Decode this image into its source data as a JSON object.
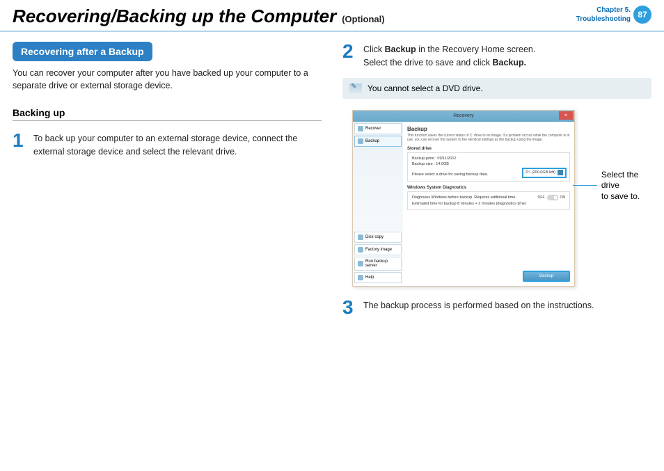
{
  "header": {
    "title": "Recovering/Backing up the Computer",
    "subtitle": "(Optional)",
    "chapter_line1": "Chapter 5.",
    "chapter_line2": "Troubleshooting",
    "page_number": "87"
  },
  "left": {
    "section_heading": "Recovering after a Backup",
    "intro": "You can recover your computer after you have backed up your computer to a separate drive or external storage device.",
    "sub_heading": "Backing up",
    "step1_num": "1",
    "step1_text": "To back up your computer to an external storage device, connect the external storage device and select the relevant drive."
  },
  "right": {
    "step2_num": "2",
    "step2_text_a": "Click ",
    "step2_bold_a": "Backup",
    "step2_text_b": " in the Recovery Home screen.",
    "step2_text_c": "Select the drive to save and click ",
    "step2_bold_b": "Backup.",
    "note": "You cannot select a DVD drive.",
    "step3_num": "3",
    "step3_text": "The backup process is performed based on the instructions."
  },
  "screenshot": {
    "title": "Recovery",
    "sidebar_recover": "Recover",
    "sidebar_backup": "Backup",
    "sidebar_diskcopy": "Disk copy",
    "sidebar_factory": "Factory image",
    "sidebar_run": "Run backup server",
    "sidebar_help": "Help",
    "panel_title": "Backup",
    "panel_desc": "This function saves the current status of C: drive to an image.\nIf a problem occurs while the computer is in use, you can recover the system to the identical settings as the backup using the image.",
    "section_stored": "Stored drive",
    "backup_point": "Backup point : 09/11/2012",
    "backup_size": "Backup size : 14.0GB",
    "select_prompt": "Please select a drive for saving backup data.",
    "drive_value": "D:\\ (200.0GB left)",
    "section_diag": "Windows System Diagnostics",
    "diag_text": "Diagnoses Windows before backup. Requires additional time.\nEstimated time for backup 8 minutes + 2 minutes (diagnostics time)",
    "toggle_off": "OFF",
    "toggle_on": "ON",
    "backup_btn": "Backup",
    "callout_line1": "Select the drive",
    "callout_line2": "to save to."
  }
}
